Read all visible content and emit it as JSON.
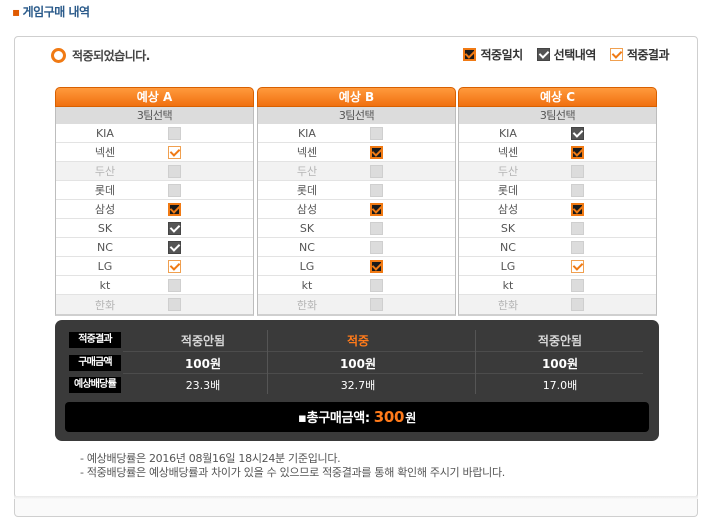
{
  "page_title": "게임구매 내역",
  "title_bullet": "▪",
  "status_text": "적중되었습니다.",
  "legend": {
    "hit": "적중일치",
    "selected": "선택내역",
    "result": "적중결과"
  },
  "columns": [
    {
      "header": "예상 A",
      "sub": "3팀선택",
      "rows": [
        {
          "team": "KIA",
          "state": "empty",
          "dim": false
        },
        {
          "team": "넥센",
          "state": "res",
          "dim": false
        },
        {
          "team": "두산",
          "state": "empty",
          "dim": true
        },
        {
          "team": "롯데",
          "state": "empty",
          "dim": false
        },
        {
          "team": "삼성",
          "state": "hit",
          "dim": false
        },
        {
          "team": "SK",
          "state": "sel",
          "dim": false
        },
        {
          "team": "NC",
          "state": "sel",
          "dim": false
        },
        {
          "team": "LG",
          "state": "res",
          "dim": false
        },
        {
          "team": "kt",
          "state": "empty",
          "dim": false
        },
        {
          "team": "한화",
          "state": "empty",
          "dim": true
        }
      ]
    },
    {
      "header": "예상 B",
      "sub": "3팀선택",
      "rows": [
        {
          "team": "KIA",
          "state": "empty",
          "dim": false
        },
        {
          "team": "넥센",
          "state": "hit",
          "dim": false
        },
        {
          "team": "두산",
          "state": "empty",
          "dim": true
        },
        {
          "team": "롯데",
          "state": "empty",
          "dim": false
        },
        {
          "team": "삼성",
          "state": "hit",
          "dim": false
        },
        {
          "team": "SK",
          "state": "empty",
          "dim": false
        },
        {
          "team": "NC",
          "state": "empty",
          "dim": false
        },
        {
          "team": "LG",
          "state": "hit",
          "dim": false
        },
        {
          "team": "kt",
          "state": "empty",
          "dim": false
        },
        {
          "team": "한화",
          "state": "empty",
          "dim": true
        }
      ]
    },
    {
      "header": "예상 C",
      "sub": "3팀선택",
      "rows": [
        {
          "team": "KIA",
          "state": "sel",
          "dim": false
        },
        {
          "team": "넥센",
          "state": "hit",
          "dim": false
        },
        {
          "team": "두산",
          "state": "empty",
          "dim": true
        },
        {
          "team": "롯데",
          "state": "empty",
          "dim": false
        },
        {
          "team": "삼성",
          "state": "hit",
          "dim": false
        },
        {
          "team": "SK",
          "state": "empty",
          "dim": false
        },
        {
          "team": "NC",
          "state": "empty",
          "dim": false
        },
        {
          "team": "LG",
          "state": "res",
          "dim": false
        },
        {
          "team": "kt",
          "state": "empty",
          "dim": false
        },
        {
          "team": "한화",
          "state": "empty",
          "dim": true
        }
      ]
    }
  ],
  "summary": {
    "labels": {
      "result": "적중결과",
      "amount": "구매금액",
      "odds": "예상배당률"
    },
    "results": [
      "적중안됨",
      "적중",
      "적중안됨"
    ],
    "amounts": [
      "100원",
      "100원",
      "100원"
    ],
    "odds": [
      "23.3배",
      "32.7배",
      "17.0배"
    ],
    "total_label": "▪총구매금액:",
    "total_amount": "300",
    "total_unit": "원"
  },
  "notes": [
    "- 예상배당률은 2016년 08월16일 18시24분 기준입니다.",
    "- 적중배당률은 예상배당률과 차이가 있을 수 있으므로 적중결과를 통해 확인해 주시기 바랍니다."
  ],
  "colors": {
    "accent": "#f07a14",
    "summary_bg": "#3a3a3a",
    "win_text": "#ff7a1a"
  }
}
